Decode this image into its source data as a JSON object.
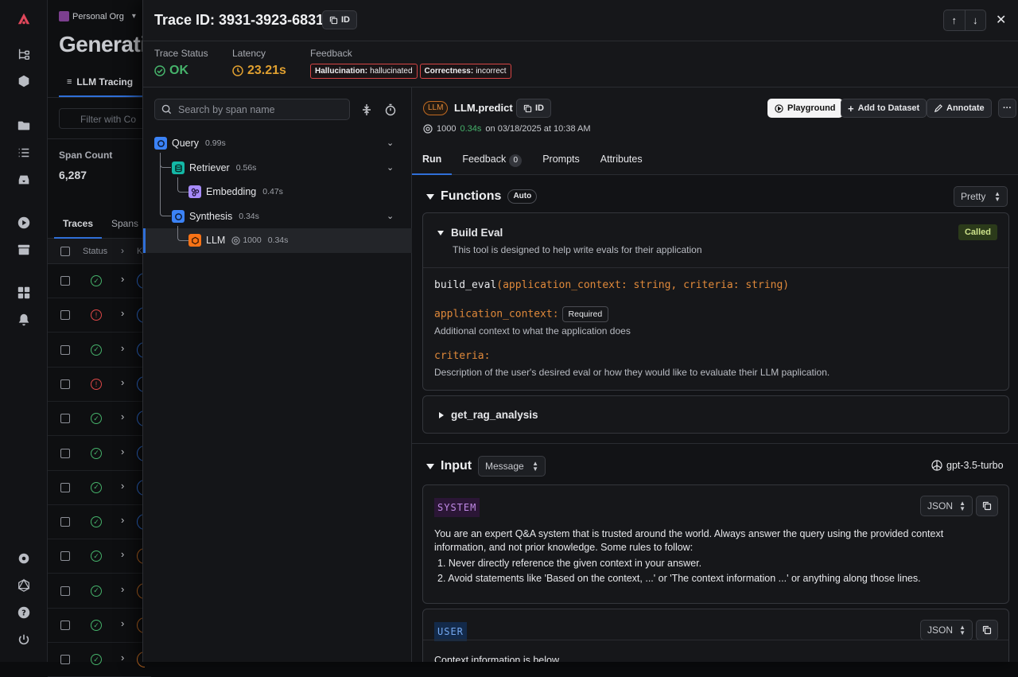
{
  "org": {
    "name": "Personal Org"
  },
  "bg": {
    "page_title": "Generati",
    "tab_label": "LLM Tracing",
    "filter_placeholder": "Filter with Co",
    "span_count_label": "Span Count",
    "span_count_value": "6,287",
    "tabs": [
      "Traces",
      "Spans"
    ],
    "table_header": {
      "status": "Status",
      "kind": "K"
    },
    "row_statuses": [
      "ok",
      "error",
      "ok",
      "error",
      "ok",
      "ok",
      "ok",
      "ok",
      "ok",
      "ok",
      "ok",
      "ok"
    ]
  },
  "drawer": {
    "title": "Trace ID: 3931-3923-6831",
    "id_button": "ID",
    "stats": {
      "status_label": "Trace Status",
      "status_value": "OK",
      "latency_label": "Latency",
      "latency_value": "23.21s",
      "feedback_label": "Feedback",
      "feedback_tags": [
        {
          "name": "Hallucination:",
          "value": "hallucinated"
        },
        {
          "name": "Correctness:",
          "value": "incorrect"
        }
      ]
    }
  },
  "tree": {
    "search_placeholder": "Search by span name",
    "nodes": [
      {
        "label": "Query",
        "duration": "0.99s",
        "kind": "chain"
      },
      {
        "label": "Retriever",
        "duration": "0.56s",
        "kind": "retriever"
      },
      {
        "label": "Embedding",
        "duration": "0.47s",
        "kind": "embedding"
      },
      {
        "label": "Synthesis",
        "duration": "0.34s",
        "kind": "chain"
      },
      {
        "label": "LLM",
        "tokens": "1000",
        "duration": "0.34s",
        "kind": "llm"
      }
    ]
  },
  "detail": {
    "kind_badge": "LLM",
    "span_name": "LLM.predict",
    "id_button": "ID",
    "tokens": "1000",
    "latency": "0.34s",
    "timestamp": "on 03/18/2025 at 10:38 AM",
    "actions": {
      "playground": "Playground",
      "add_to_dataset": "Add to Dataset",
      "annotate": "Annotate",
      "more": "···"
    },
    "tabs": {
      "run": "Run",
      "feedback": "Feedback",
      "feedback_count": "0",
      "prompts": "Prompts",
      "attributes": "Attributes"
    }
  },
  "functions": {
    "title": "Functions",
    "auto_badge": "Auto",
    "format_select": "Pretty",
    "build_eval": {
      "name": "Build Eval",
      "called_badge": "Called",
      "description": "This tool is designed to help write evals for their application",
      "signature_name": "build_eval",
      "signature_params": "(application_context: string, criteria: string)",
      "params": [
        {
          "name": "application_context:",
          "required": "Required",
          "description": "Additional context to what the application does"
        },
        {
          "name": "criteria:",
          "required": "",
          "description": "Description of the user's desired eval or how they would like to evaluate their LLM paplication."
        }
      ]
    },
    "rag": {
      "name": "get_rag_analysis"
    }
  },
  "input": {
    "title": "Input",
    "mode_select": "Message",
    "model": "gpt-3.5-turbo",
    "system": {
      "role": "SYSTEM",
      "format": "JSON",
      "text": "You are an expert Q&A system that is trusted around the world. Always answer the query using the provided context information, and not prior knowledge. Some rules to follow:",
      "rules": [
        "1.  Never directly reference the given context in your answer.",
        "2.  Avoid statements like 'Based on the context, ...' or 'The context information ...' or anything along those lines."
      ]
    },
    "user": {
      "role": "USER",
      "format": "JSON",
      "text": "Context information is below."
    }
  },
  "colors": {
    "accent": "#2f6fd8",
    "ok": "#46b36b",
    "error": "#e04848",
    "latency": "#e0a030",
    "llm": "#e0893a"
  }
}
